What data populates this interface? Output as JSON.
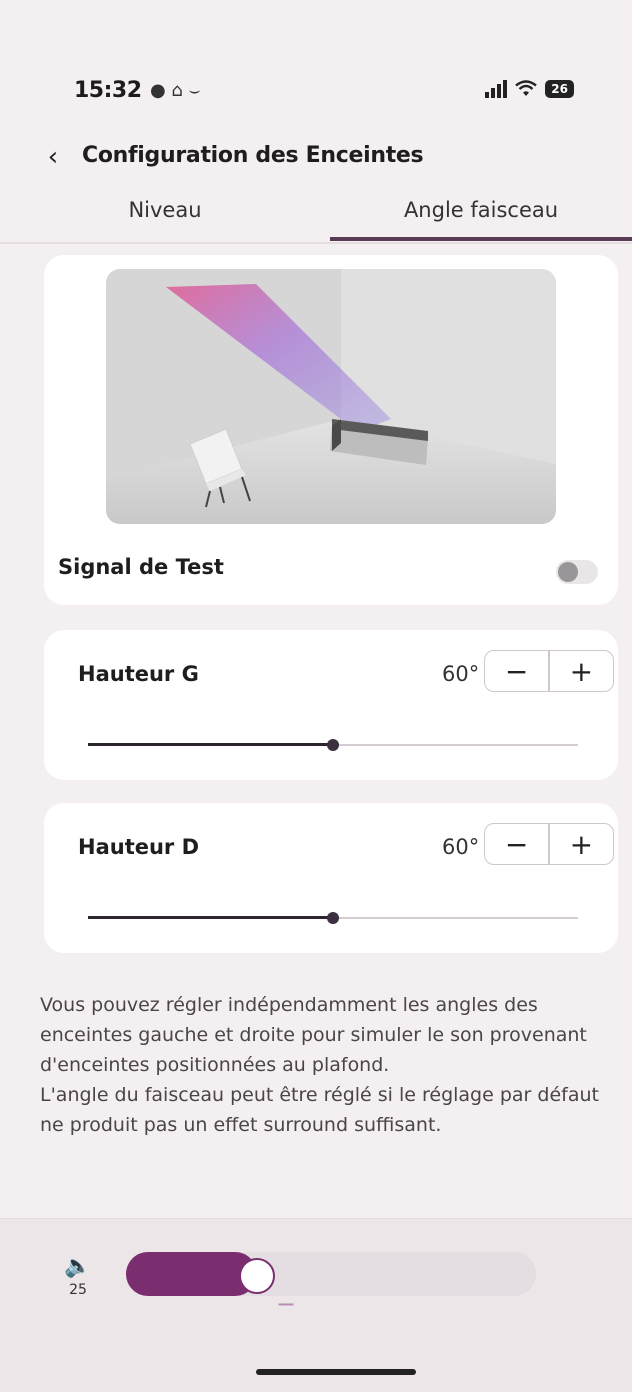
{
  "status": {
    "time": "15:32",
    "left_icons": "● ⌂ ⌣",
    "battery": "26"
  },
  "header": {
    "back_icon": "‹",
    "title": "Configuration des Enceintes"
  },
  "tabs": [
    {
      "label": "Niveau",
      "active": false
    },
    {
      "label": "Angle faisceau",
      "active": true
    }
  ],
  "test_signal": {
    "label": "Signal de Test",
    "enabled": false
  },
  "heights": [
    {
      "label": "Hauteur G",
      "value": "60°",
      "level": 0.5
    },
    {
      "label": "Hauteur D",
      "value": "60°",
      "level": 0.5
    }
  ],
  "stepper": {
    "minus": "−",
    "plus": "+"
  },
  "description": "Vous pouvez régler indépendamment les angles des enceintes gauche et droite pour simuler le son provenant d'enceintes positionnées au plafond.\nL'angle du faisceau peut être réglé si le réglage par défaut ne produit pas un effet surround suffisant.",
  "volume": {
    "icon": "🔈",
    "value": "25",
    "level": 0.27,
    "minus": "−",
    "plus": "+"
  },
  "colors": {
    "accent": "#7a2e70",
    "tab_active": "#5a3a55"
  }
}
